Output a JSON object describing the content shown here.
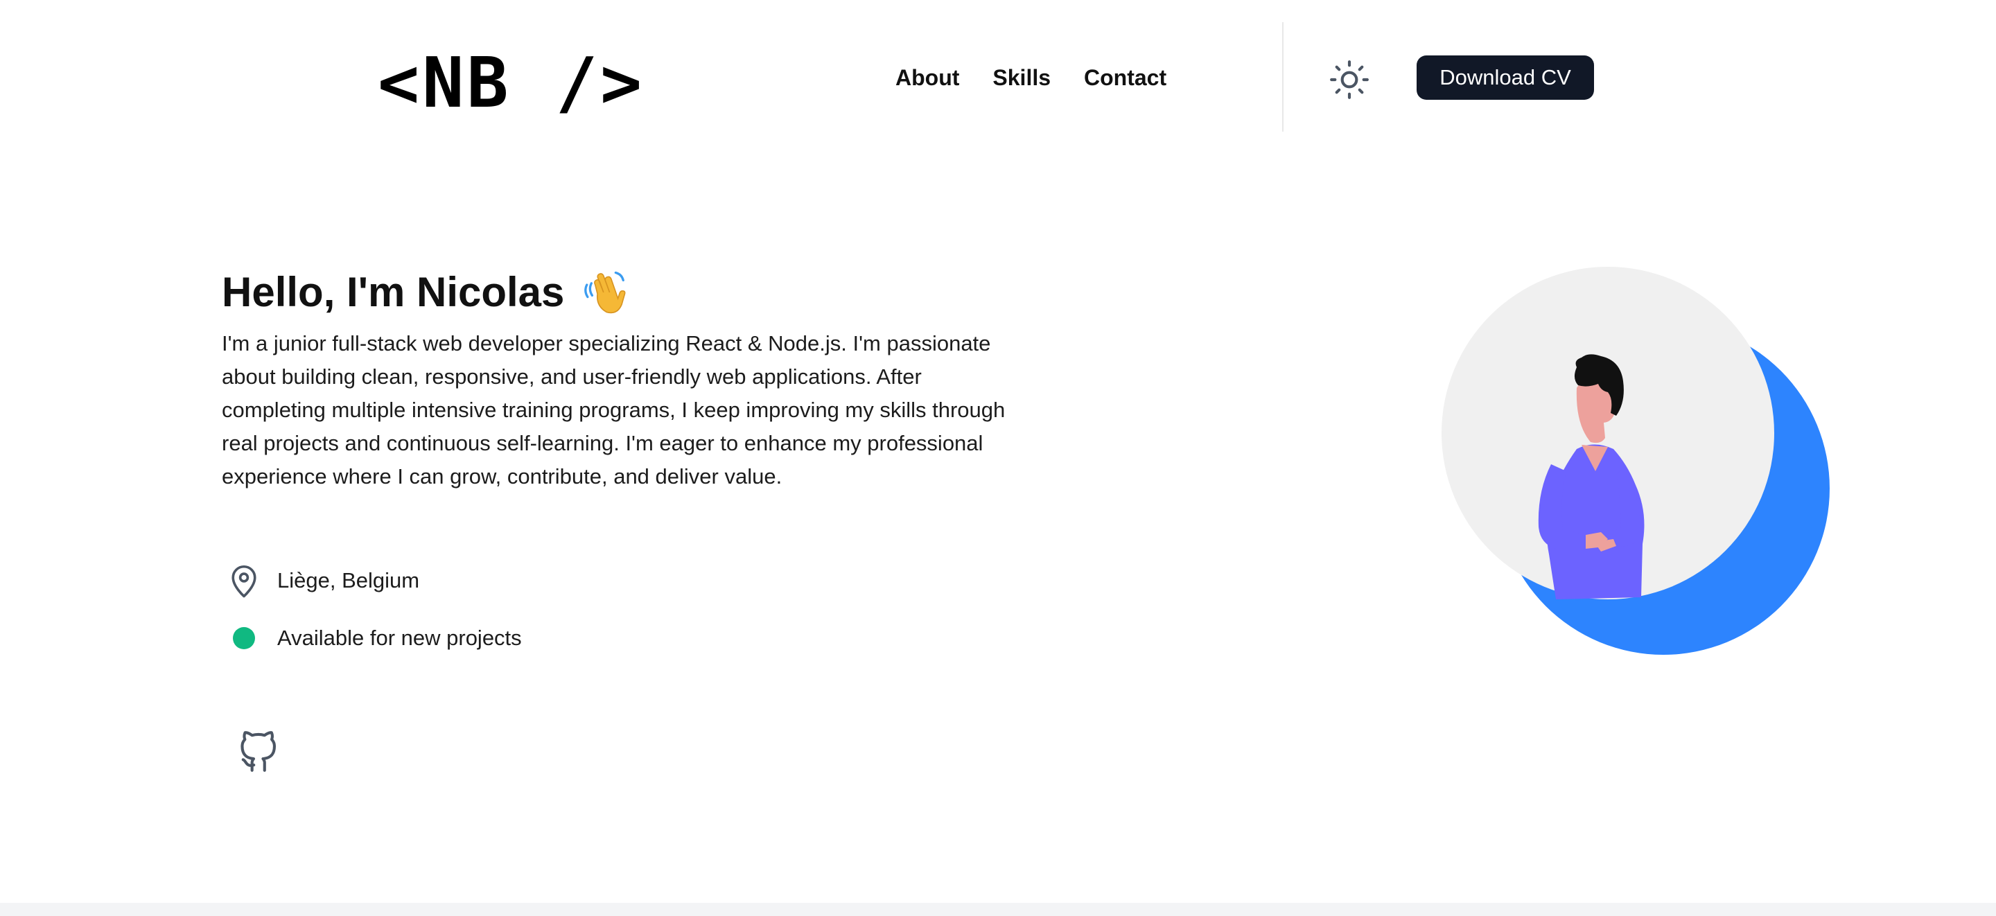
{
  "header": {
    "logo": "<NB />",
    "nav": [
      "About",
      "Skills",
      "Contact"
    ],
    "theme_toggle_icon": "sun-icon",
    "download_cv_label": "Download CV",
    "button_color": "#111827"
  },
  "hero": {
    "title": "Hello, I'm Nicolas",
    "title_emoji_icon": "waving-hand-icon",
    "description": "I'm a junior full-stack web developer specializing React & Node.js. I'm passionate about building clean, responsive, and user-friendly web applications. After completing multiple intensive training programs, I keep improving my skills through real projects and continuous self-learning. I'm eager to enhance my professional experience where I can grow, contribute, and deliver value.",
    "location": "Liège, Belgium",
    "location_icon": "map-pin-icon",
    "availability": "Available for new projects",
    "availability_color": "#10b981",
    "social_icon": "github-icon"
  },
  "illustration": {
    "accent_color": "#2d84fe",
    "circle_color": "#f0f0f0",
    "shirt_color": "#6c63ff"
  }
}
